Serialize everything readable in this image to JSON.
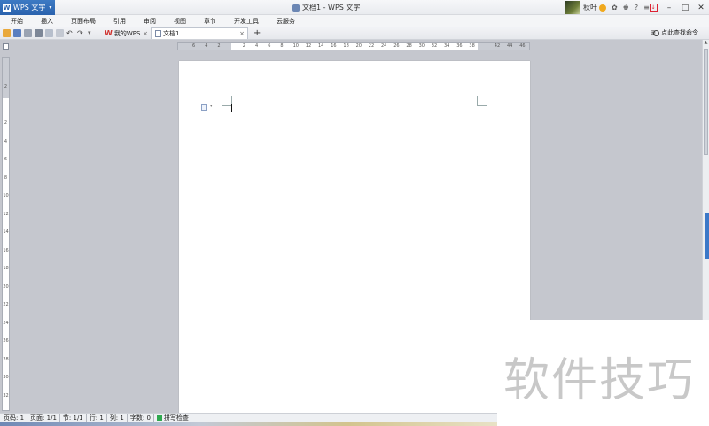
{
  "titlebar": {
    "app_menu_label": "WPS 文字",
    "app_logo_letter": "W",
    "document_title": "文档1 - WPS 文字",
    "user_name": "秋叶",
    "help_label": "?"
  },
  "menu_tabs": [
    "开始",
    "插入",
    "页面布局",
    "引用",
    "审阅",
    "视图",
    "章节",
    "开发工具",
    "云服务"
  ],
  "doc_tabs": {
    "tab1_label": "我的WPS",
    "tab2_label": "文档1",
    "close_glyph": "×",
    "new_tab_glyph": "+"
  },
  "search": {
    "label": "点此查找命令"
  },
  "ruler": {
    "horizontal_labels": [
      "6",
      "4",
      "2",
      "",
      "2",
      "4",
      "6",
      "8",
      "10",
      "12",
      "14",
      "16",
      "18",
      "20",
      "22",
      "24",
      "26",
      "28",
      "30",
      "32",
      "34",
      "36",
      "38",
      "",
      "42",
      "44",
      "46"
    ],
    "vertical_labels": [
      "2",
      "",
      "2",
      "4",
      "6",
      "8",
      "10",
      "12",
      "14",
      "16",
      "18",
      "20",
      "22",
      "24",
      "26",
      "28",
      "30",
      "32"
    ]
  },
  "statusbar": {
    "page": "页码: 1",
    "pages": "页面: 1/1",
    "section": "节: 1/1",
    "row": "行: 1",
    "col": "列: 1",
    "wordcount": "字数: 0",
    "spellcheck": "拼写检查"
  },
  "watermark": {
    "text": "软件技巧"
  }
}
